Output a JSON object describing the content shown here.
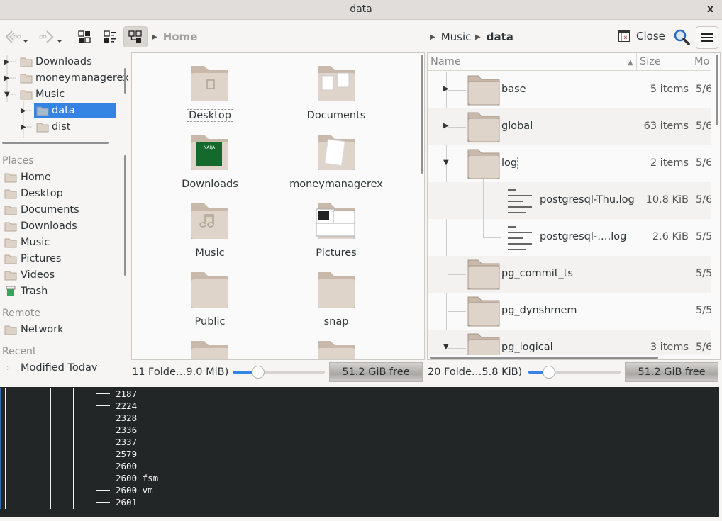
{
  "window": {
    "title": "data",
    "close_label": "x"
  },
  "toolbar": {
    "back_icon": "back-arrow",
    "forward_icon": "forward-arrow",
    "view_icons": "icons-view",
    "view_details": "details-view",
    "view_tree": "tree-view",
    "breadcrumb_left": "Home",
    "breadcrumb_right": [
      "Music",
      "data"
    ],
    "close_label": "Close",
    "search_icon": "search",
    "menu_icon": "hamburger"
  },
  "sidebar": {
    "tree": [
      {
        "label": "Downloads",
        "expanded": false
      },
      {
        "label": "moneymanagerex",
        "expanded": false
      },
      {
        "label": "Music",
        "expanded": true
      },
      {
        "label": "data",
        "expanded": false,
        "selected": true
      },
      {
        "label": "dist",
        "expanded": false
      }
    ],
    "places_heading": "Places",
    "places": [
      "Home",
      "Desktop",
      "Documents",
      "Downloads",
      "Music",
      "Pictures",
      "Videos",
      "Trash"
    ],
    "remote_heading": "Remote",
    "remote": [
      "Network"
    ],
    "recent_heading": "Recent",
    "recent": [
      "Modified Today"
    ]
  },
  "icon_pane": {
    "items": [
      "Desktop",
      "Documents",
      "Downloads",
      "moneymanagerex",
      "Music",
      "Pictures",
      "Public",
      "snap"
    ],
    "status": "11 Folde…9.0 MiB)",
    "zoom_fraction": 0.28,
    "free_space": "51.2 GiB free"
  },
  "list_pane": {
    "columns": {
      "name": "Name",
      "size": "Size",
      "modified": "Mo"
    },
    "rows": [
      {
        "name": "base",
        "size": "5 items",
        "modified": "5/6",
        "type": "folder",
        "level": 0,
        "expander": "collapsed"
      },
      {
        "name": "global",
        "size": "63 items",
        "modified": "5/6",
        "type": "folder",
        "level": 0,
        "expander": "collapsed"
      },
      {
        "name": "log",
        "size": "2 items",
        "modified": "5/6",
        "type": "folder",
        "level": 0,
        "expander": "expanded"
      },
      {
        "name": "postgresql-Thu.log",
        "size": "10.8 KiB",
        "modified": "5/6",
        "type": "file",
        "level": 1
      },
      {
        "name": "postgresql-….log",
        "size": "2.6 KiB",
        "modified": "5/5",
        "type": "file",
        "level": 1
      },
      {
        "name": "pg_commit_ts",
        "size": "",
        "modified": "5/5",
        "type": "folder",
        "level": 0
      },
      {
        "name": "pg_dynshmem",
        "size": "",
        "modified": "5/5",
        "type": "folder",
        "level": 0
      },
      {
        "name": "pg_logical",
        "size": "3 items",
        "modified": "5/6",
        "type": "folder",
        "level": 0,
        "expander": "expanded"
      }
    ],
    "status": "20 Folde…5.8 KiB)",
    "zoom_fraction": 0.22,
    "free_space": "51.2 GiB free"
  },
  "terminal": {
    "lines": [
      "2187",
      "2224",
      "2328",
      "2336",
      "2337",
      "2579",
      "2600",
      "2600_fsm",
      "2600_vm",
      "2601"
    ]
  }
}
